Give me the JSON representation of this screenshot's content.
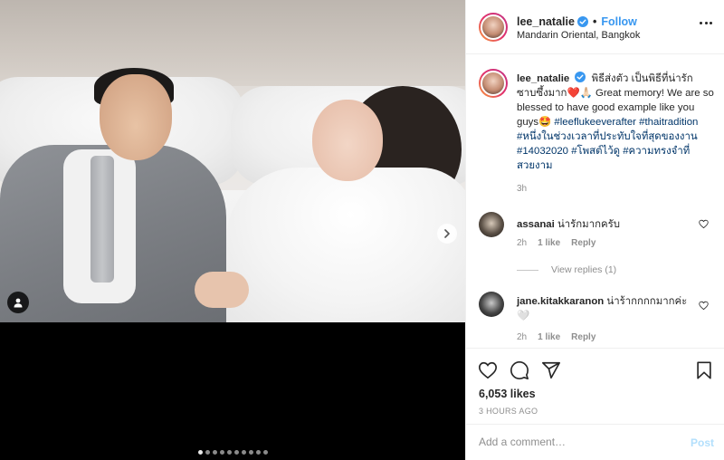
{
  "post": {
    "username": "lee_natalie",
    "follow_label": "Follow",
    "separator": "•",
    "location": "Mandarin Oriental, Bangkok"
  },
  "media": {
    "slide_count": 10,
    "active_slide": 1
  },
  "caption": {
    "username": "lee_natalie",
    "text_part1": "พิธีส่งตัว เป็นพิธีที่น่ารักซาบซึ้งมาก❤️🙏🏻 Great memory! We are so blessed to have good example like you guys🤩 ",
    "hashtags": [
      "#leeflukeeverafter",
      "#thaitradition",
      "#หนึ่งในช่วงเวลาที่ประทับใจที่สุดของงาน",
      "#14032020",
      "#โพสต์ไว้ดู",
      "#ความทรงจำที่สวยงาม"
    ],
    "time": "3h"
  },
  "comments": [
    {
      "username": "assanai",
      "text": "น่ารักมากครับ",
      "time": "2h",
      "likes": "1 like",
      "reply": "Reply"
    },
    {
      "username": "jane.kitakkaranon",
      "text": "น่าร้ากกกกมากค่ะ 🤍",
      "time": "2h",
      "likes": "1 like",
      "reply": "Reply"
    }
  ],
  "view_replies": "View replies (1)",
  "stats": {
    "likes": "6,053 likes",
    "posted_ago": "3 HOURS AGO"
  },
  "comment_box": {
    "placeholder": "Add a comment…",
    "post_label": "Post"
  },
  "colors": {
    "accent": "#3897f0",
    "verified": "#3897f0",
    "muted": "#8e8e8e",
    "post_disabled": "#b2dffc"
  },
  "icons": {
    "verified": "verified-badge-icon",
    "more": "more-options-icon",
    "heart": "heart-icon",
    "comment": "comment-icon",
    "share": "share-icon",
    "save": "bookmark-icon",
    "next": "chevron-right-icon",
    "user_tag": "user-tag-icon"
  }
}
